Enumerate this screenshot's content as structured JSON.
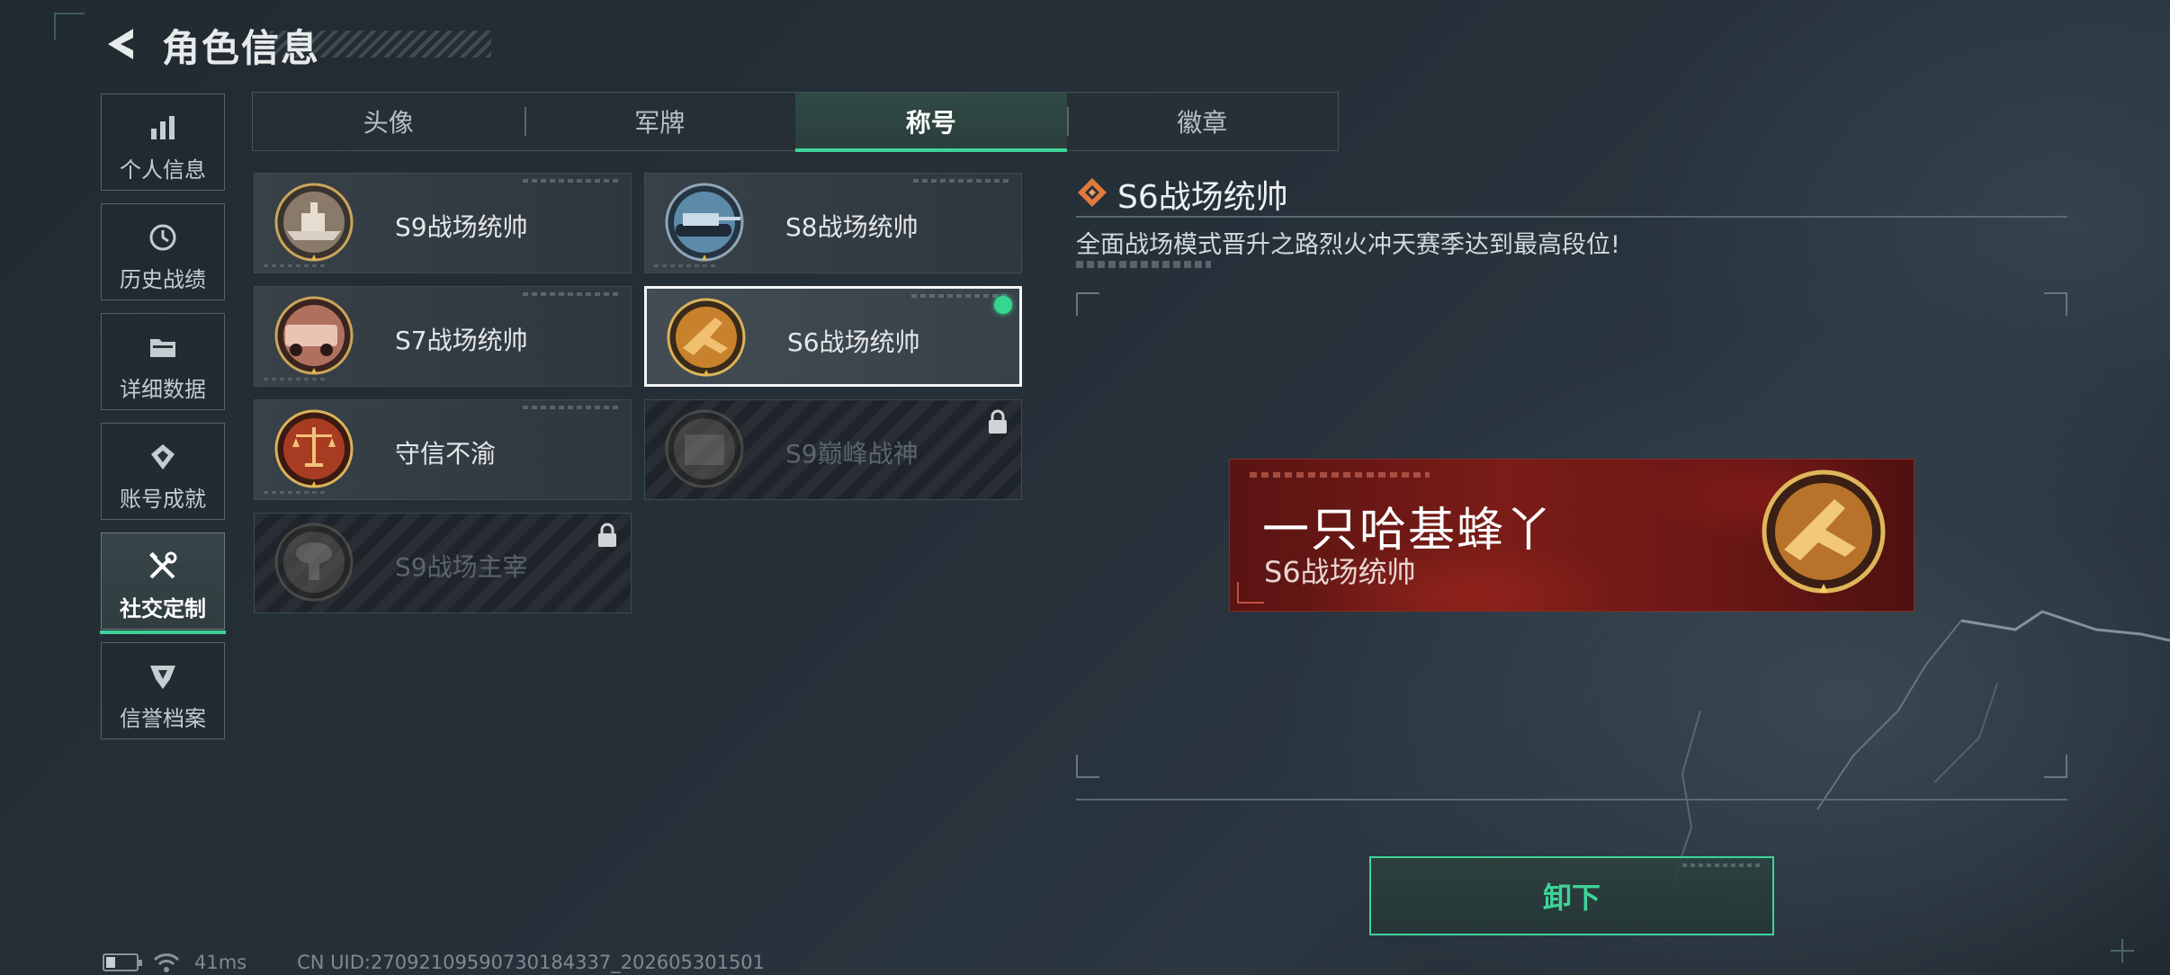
{
  "header": {
    "title": "角色信息"
  },
  "sidebar": {
    "items": [
      {
        "label": "个人信息",
        "icon": "bar-chart-icon"
      },
      {
        "label": "历史战绩",
        "icon": "history-clock-icon"
      },
      {
        "label": "详细数据",
        "icon": "folder-icon"
      },
      {
        "label": "账号成就",
        "icon": "achievement-icon"
      },
      {
        "label": "社交定制",
        "icon": "tools-icon",
        "active": true
      },
      {
        "label": "信誉档案",
        "icon": "reputation-shield-icon"
      }
    ]
  },
  "tabs": [
    {
      "label": "头像"
    },
    {
      "label": "军牌"
    },
    {
      "label": "称号",
      "active": true
    },
    {
      "label": "徽章"
    }
  ],
  "titles": [
    {
      "name": "S9战场统帅",
      "medal": "battleship-medal-icon",
      "medal_color": "#8a7a6a",
      "locked": false
    },
    {
      "name": "S8战场统帅",
      "medal": "tank-medal-icon",
      "medal_color": "#5d8aa8",
      "locked": false
    },
    {
      "name": "S7战场统帅",
      "medal": "armored-vehicle-medal-icon",
      "medal_color": "#b07060",
      "locked": false
    },
    {
      "name": "S6战场统帅",
      "medal": "jet-medal-icon",
      "medal_color": "#c8822e",
      "locked": false,
      "selected": true,
      "equipped": true
    },
    {
      "name": "守信不渝",
      "medal": "scales-medal-icon",
      "medal_color": "#a83c22",
      "locked": false
    },
    {
      "name": "S9巅峰战神",
      "medal": "fortress-medal-icon",
      "medal_color": "#6a625a",
      "locked": true
    },
    {
      "name": "S9战场主宰",
      "medal": "explosion-medal-icon",
      "medal_color": "#6a625a",
      "locked": true
    }
  ],
  "detail": {
    "title": "S6战场统帅",
    "description": "全面战场模式晋升之路烈火冲天赛季达到最高段位!"
  },
  "preview": {
    "player_name": "一只哈基蜂丫",
    "title": "S6战场统帅"
  },
  "unequip_label": "卸下",
  "status": {
    "ping": "41ms",
    "uid": "CN UID:27092109590730184337_202605301501"
  },
  "colors": {
    "accent": "#3fd39a",
    "equipped_dot": "#35d68f",
    "banner_red": "#7a1c18",
    "detail_icon": "#e07a3a"
  }
}
